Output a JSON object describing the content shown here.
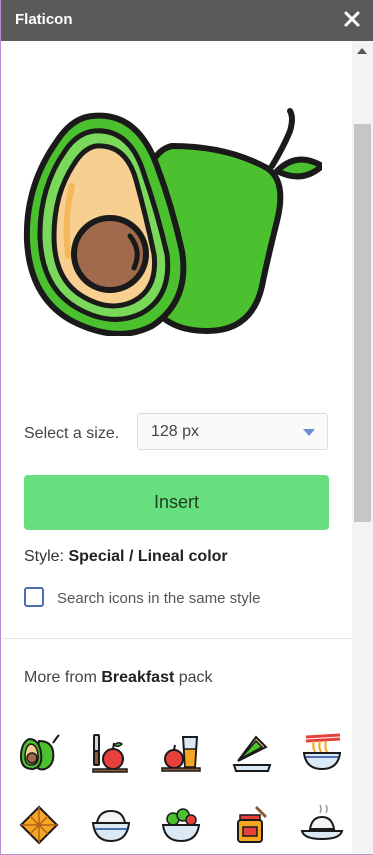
{
  "header": {
    "title": "Flaticon",
    "close_icon": "close-icon"
  },
  "preview": {
    "icon": "avocado-icon",
    "colors": {
      "outline": "#1a1a1a",
      "green": "#4cc12f",
      "light_green": "#7ad85a",
      "flesh": "#f7cf91",
      "pit": "#a26a4c"
    }
  },
  "size": {
    "label": "Select a size.",
    "selected": "128 px"
  },
  "insert": {
    "label": "Insert",
    "color": "#66e07f"
  },
  "style": {
    "prefix": "Style:",
    "value": "Special / Lineal color"
  },
  "search_same_style": {
    "label": "Search icons in the same style",
    "checked": false
  },
  "more": {
    "prefix": "More from",
    "pack": "Breakfast",
    "suffix": "pack"
  },
  "pack_icons": [
    "avocado-icon",
    "apple-knife-icon",
    "juice-apple-icon",
    "sandwich-icon",
    "noodles-bowl-icon",
    "waffle-icon",
    "rice-bowl-icon",
    "salad-bowl-icon",
    "honey-jar-icon",
    "rice-plate-icon"
  ]
}
